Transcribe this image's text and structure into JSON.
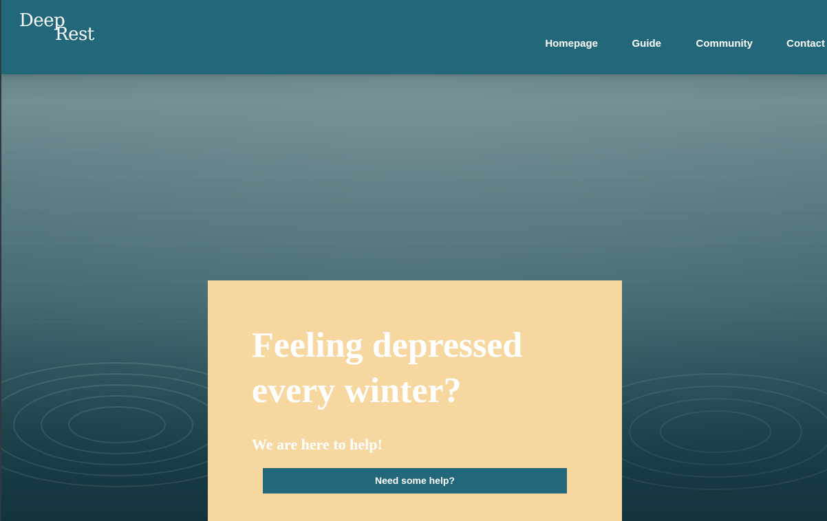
{
  "brand": {
    "logo_line1": "Deep",
    "logo_line2": "Rest"
  },
  "nav": {
    "items": [
      {
        "label": "Homepage"
      },
      {
        "label": "Guide"
      },
      {
        "label": "Community"
      },
      {
        "label": "Contact"
      }
    ]
  },
  "hero": {
    "title": "Feeling depressed every winter?",
    "subtitle": "We are here to help!",
    "cta_label": "Need some help?"
  },
  "colors": {
    "header_bg": "#23677a",
    "card_bg": "#f7d7a0",
    "button_bg": "#23677a",
    "text_light": "#ffffff"
  }
}
